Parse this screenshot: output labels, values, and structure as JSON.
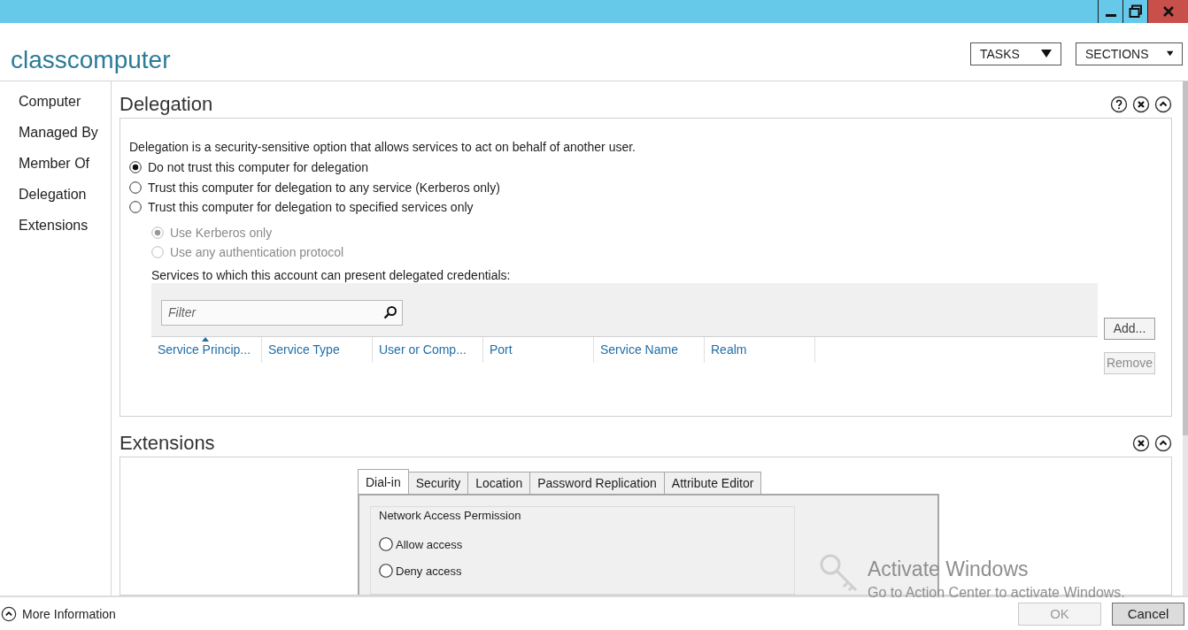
{
  "header": {
    "title": "classcomputer",
    "buttons": [
      {
        "label": "TASKS"
      },
      {
        "label": "SECTIONS"
      }
    ]
  },
  "nav": {
    "items": [
      {
        "label": "Computer"
      },
      {
        "label": "Managed By"
      },
      {
        "label": "Member Of"
      },
      {
        "label": "Delegation"
      },
      {
        "label": "Extensions"
      }
    ]
  },
  "delegation": {
    "title": "Delegation",
    "description": "Delegation is a security-sensitive option that allows services to act on behalf of another user.",
    "options": [
      {
        "label": "Do not trust this computer for delegation",
        "selected": true
      },
      {
        "label": "Trust this computer for delegation to any service (Kerberos only)",
        "selected": false
      },
      {
        "label": "Trust this computer for delegation to specified services only",
        "selected": false
      }
    ],
    "sub_options": [
      {
        "label": "Use Kerberos only",
        "selected": true,
        "disabled": true
      },
      {
        "label": "Use any authentication protocol",
        "selected": false,
        "disabled": true
      }
    ],
    "services_label": "Services to which this account can present delegated credentials:",
    "filter": {
      "placeholder": "Filter"
    },
    "columns": [
      {
        "label": "Service Princip...",
        "sorted": true
      },
      {
        "label": "Service Type",
        "sorted": false
      },
      {
        "label": "User or Comp...",
        "sorted": false
      },
      {
        "label": "Port",
        "sorted": false
      },
      {
        "label": "Service Name",
        "sorted": false
      },
      {
        "label": "Realm",
        "sorted": false
      }
    ],
    "buttons": [
      {
        "label": "Add...",
        "disabled": false
      },
      {
        "label": "Remove",
        "disabled": true
      }
    ]
  },
  "extensions": {
    "title": "Extensions",
    "tabs": [
      {
        "label": "Dial-in",
        "selected": true
      },
      {
        "label": "Security",
        "selected": false
      },
      {
        "label": "Location",
        "selected": false
      },
      {
        "label": "Password Replication",
        "selected": false
      },
      {
        "label": "Attribute Editor",
        "selected": false
      }
    ],
    "group": {
      "title": "Network Access Permission",
      "options": [
        {
          "label": "Allow access",
          "selected": false
        },
        {
          "label": "Deny access",
          "selected": false
        }
      ]
    }
  },
  "activation": {
    "title": "Activate Windows",
    "subtitle": "Go to Action Center to activate Windows."
  },
  "footer": {
    "more_info": "More Information",
    "buttons": [
      {
        "label": "OK",
        "disabled": true
      },
      {
        "label": "Cancel",
        "disabled": false
      }
    ]
  }
}
